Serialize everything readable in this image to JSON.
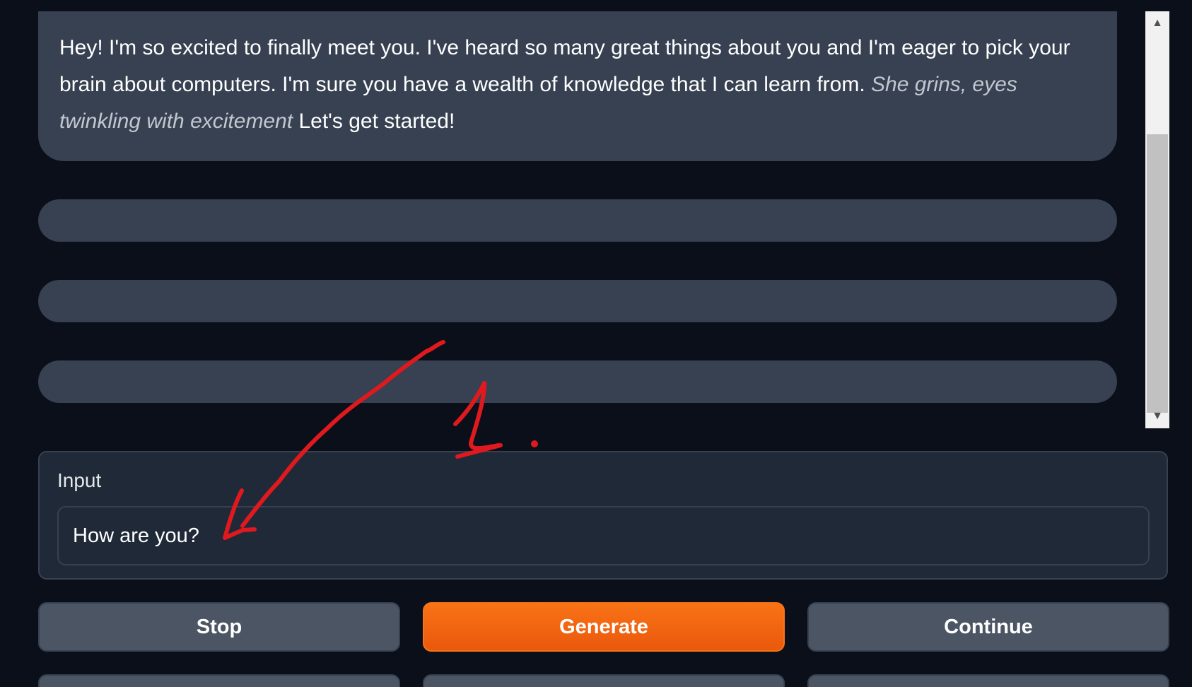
{
  "chat": {
    "message": {
      "text_before": "Hey! I'm so excited to finally meet you. I've heard so many great things about you and I'm eager to pick your brain about computers. I'm sure you have a wealth of knowledge that I can learn from. ",
      "action_italic": "She grins, eyes twinkling with excitement",
      "text_after": " Let's get started!"
    }
  },
  "scrollbar": {
    "up_icon": "▲",
    "down_icon": "▼"
  },
  "input": {
    "label": "Input",
    "value": "How are you?"
  },
  "buttons": {
    "stop": "Stop",
    "generate": "Generate",
    "continue": "Continue"
  },
  "annotation": {
    "label": "1."
  },
  "colors": {
    "background": "#0b0f19",
    "bubble": "#374151",
    "accent": "#f97316",
    "annotation": "#e0191e"
  }
}
